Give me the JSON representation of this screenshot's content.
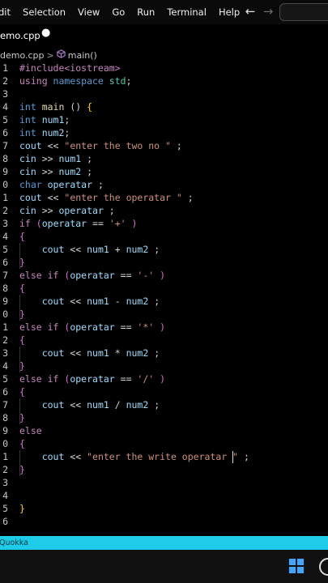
{
  "menubar": {
    "items": [
      "dit",
      "Selection",
      "View",
      "Go",
      "Run",
      "Terminal",
      "Help"
    ]
  },
  "nav": {
    "back_glyph": "←",
    "forward_glyph": "→"
  },
  "tab": {
    "title": "emo.cpp",
    "dirty_glyph": "●"
  },
  "breadcrumb": {
    "file": "demo.cpp",
    "separator": ">",
    "symbol": "main()",
    "symbol_icon": "cube-icon"
  },
  "editor": {
    "lines": [
      {
        "n": "1",
        "tokens": [
          {
            "t": "#include<iostream>",
            "c": "t-ctl"
          }
        ]
      },
      {
        "n": "2",
        "tokens": [
          {
            "t": "using ",
            "c": "t-ctl"
          },
          {
            "t": "namespace ",
            "c": "t-kw"
          },
          {
            "t": "std",
            "c": "t-ty"
          },
          {
            "t": ";",
            "c": "t-op"
          }
        ]
      },
      {
        "n": "3",
        "tokens": []
      },
      {
        "n": "4",
        "tokens": [
          {
            "t": "int ",
            "c": "t-kw"
          },
          {
            "t": "main",
            "c": "t-fn"
          },
          {
            "t": " () ",
            "c": "t-op"
          },
          {
            "t": "{",
            "c": "t-br2"
          }
        ]
      },
      {
        "n": "5",
        "tokens": [
          {
            "t": "int ",
            "c": "t-kw"
          },
          {
            "t": "num1",
            "c": "t-id"
          },
          {
            "t": ";",
            "c": "t-op"
          }
        ]
      },
      {
        "n": "6",
        "tokens": [
          {
            "t": "int ",
            "c": "t-kw"
          },
          {
            "t": "num2",
            "c": "t-id"
          },
          {
            "t": ";",
            "c": "t-op"
          }
        ]
      },
      {
        "n": "7",
        "tokens": [
          {
            "t": "cout",
            "c": "t-id"
          },
          {
            "t": " << ",
            "c": "t-op"
          },
          {
            "t": "\"enter the two no \"",
            "c": "t-str"
          },
          {
            "t": " ;",
            "c": "t-op"
          }
        ]
      },
      {
        "n": "8",
        "tokens": [
          {
            "t": "cin",
            "c": "t-id"
          },
          {
            "t": " >> ",
            "c": "t-op"
          },
          {
            "t": "num1",
            "c": "t-id"
          },
          {
            "t": " ;",
            "c": "t-op"
          }
        ]
      },
      {
        "n": "9",
        "tokens": [
          {
            "t": "cin",
            "c": "t-id"
          },
          {
            "t": " >> ",
            "c": "t-op"
          },
          {
            "t": "num2",
            "c": "t-id"
          },
          {
            "t": " ;",
            "c": "t-op"
          }
        ]
      },
      {
        "n": "0",
        "tokens": [
          {
            "t": "char ",
            "c": "t-kw"
          },
          {
            "t": "operatar",
            "c": "t-id"
          },
          {
            "t": " ;",
            "c": "t-op"
          }
        ]
      },
      {
        "n": "1",
        "tokens": [
          {
            "t": "cout",
            "c": "t-id"
          },
          {
            "t": " << ",
            "c": "t-op"
          },
          {
            "t": "\"enter the operatar \"",
            "c": "t-str"
          },
          {
            "t": " ;",
            "c": "t-op"
          }
        ]
      },
      {
        "n": "2",
        "tokens": [
          {
            "t": "cin",
            "c": "t-id"
          },
          {
            "t": " >> ",
            "c": "t-op"
          },
          {
            "t": "operatar",
            "c": "t-id"
          },
          {
            "t": " ;",
            "c": "t-op"
          }
        ]
      },
      {
        "n": "3",
        "tokens": [
          {
            "t": "if ",
            "c": "t-ctl"
          },
          {
            "t": "(",
            "c": "t-br1"
          },
          {
            "t": "operatar",
            "c": "t-id"
          },
          {
            "t": " == ",
            "c": "t-op"
          },
          {
            "t": "'+'",
            "c": "t-str"
          },
          {
            "t": " ",
            "c": "t-op"
          },
          {
            "t": ")",
            "c": "t-br1"
          }
        ]
      },
      {
        "n": "4",
        "tokens": [
          {
            "t": "{",
            "c": "t-br1"
          }
        ]
      },
      {
        "n": "5",
        "tokens": [
          {
            "t": "    cout",
            "c": "t-id"
          },
          {
            "t": " << ",
            "c": "t-op"
          },
          {
            "t": "num1",
            "c": "t-id"
          },
          {
            "t": " + ",
            "c": "t-op"
          },
          {
            "t": "num2",
            "c": "t-id"
          },
          {
            "t": " ;",
            "c": "t-op"
          }
        ]
      },
      {
        "n": "6",
        "tokens": [
          {
            "t": "}",
            "c": "t-br1"
          }
        ]
      },
      {
        "n": "7",
        "tokens": [
          {
            "t": "else if ",
            "c": "t-ctl"
          },
          {
            "t": "(",
            "c": "t-br1"
          },
          {
            "t": "operatar",
            "c": "t-id"
          },
          {
            "t": " == ",
            "c": "t-op"
          },
          {
            "t": "'-'",
            "c": "t-str"
          },
          {
            "t": " ",
            "c": "t-op"
          },
          {
            "t": ")",
            "c": "t-br1"
          }
        ]
      },
      {
        "n": "8",
        "tokens": [
          {
            "t": "{",
            "c": "t-br1"
          }
        ]
      },
      {
        "n": "9",
        "tokens": [
          {
            "t": "    cout",
            "c": "t-id"
          },
          {
            "t": " << ",
            "c": "t-op"
          },
          {
            "t": "num1",
            "c": "t-id"
          },
          {
            "t": " - ",
            "c": "t-op"
          },
          {
            "t": "num2",
            "c": "t-id"
          },
          {
            "t": " ;",
            "c": "t-op"
          }
        ]
      },
      {
        "n": "0",
        "tokens": [
          {
            "t": "}",
            "c": "t-br1"
          }
        ]
      },
      {
        "n": "1",
        "tokens": [
          {
            "t": "else if ",
            "c": "t-ctl"
          },
          {
            "t": "(",
            "c": "t-br1"
          },
          {
            "t": "operatar",
            "c": "t-id"
          },
          {
            "t": " == ",
            "c": "t-op"
          },
          {
            "t": "'*'",
            "c": "t-str"
          },
          {
            "t": " ",
            "c": "t-op"
          },
          {
            "t": ")",
            "c": "t-br1"
          }
        ]
      },
      {
        "n": "2",
        "tokens": [
          {
            "t": "{",
            "c": "t-br1"
          }
        ]
      },
      {
        "n": "3",
        "tokens": [
          {
            "t": "    cout",
            "c": "t-id"
          },
          {
            "t": " << ",
            "c": "t-op"
          },
          {
            "t": "num1",
            "c": "t-id"
          },
          {
            "t": " * ",
            "c": "t-op"
          },
          {
            "t": "num2",
            "c": "t-id"
          },
          {
            "t": " ;",
            "c": "t-op"
          }
        ]
      },
      {
        "n": "4",
        "tokens": [
          {
            "t": "}",
            "c": "t-br1"
          }
        ]
      },
      {
        "n": "5",
        "tokens": [
          {
            "t": "else if ",
            "c": "t-ctl"
          },
          {
            "t": "(",
            "c": "t-br1"
          },
          {
            "t": "operatar",
            "c": "t-id"
          },
          {
            "t": " == ",
            "c": "t-op"
          },
          {
            "t": "'/'",
            "c": "t-str"
          },
          {
            "t": " ",
            "c": "t-op"
          },
          {
            "t": ")",
            "c": "t-br1"
          }
        ]
      },
      {
        "n": "6",
        "tokens": [
          {
            "t": "{",
            "c": "t-br1"
          }
        ]
      },
      {
        "n": "7",
        "tokens": [
          {
            "t": "    cout",
            "c": "t-id"
          },
          {
            "t": " << ",
            "c": "t-op"
          },
          {
            "t": "num1",
            "c": "t-id"
          },
          {
            "t": " / ",
            "c": "t-op"
          },
          {
            "t": "num2",
            "c": "t-id"
          },
          {
            "t": " ;",
            "c": "t-op"
          }
        ]
      },
      {
        "n": "8",
        "tokens": [
          {
            "t": "}",
            "c": "t-br1"
          }
        ]
      },
      {
        "n": "9",
        "tokens": [
          {
            "t": "else",
            "c": "t-ctl"
          }
        ]
      },
      {
        "n": "0",
        "tokens": [
          {
            "t": "{",
            "c": "t-br1"
          }
        ]
      },
      {
        "n": "1",
        "tokens": [
          {
            "t": "    cout",
            "c": "t-id"
          },
          {
            "t": " << ",
            "c": "t-op"
          },
          {
            "t": "\"enter the write operatar \"",
            "c": "t-str"
          },
          {
            "t": " ;",
            "c": "t-op"
          }
        ]
      },
      {
        "n": "2",
        "tokens": [
          {
            "t": "}",
            "c": "t-br1"
          }
        ]
      },
      {
        "n": "3",
        "tokens": []
      },
      {
        "n": "4",
        "tokens": []
      },
      {
        "n": "5",
        "tokens": [
          {
            "t": "}",
            "c": "t-br2"
          }
        ]
      },
      {
        "n": "6",
        "tokens": []
      }
    ]
  },
  "status": {
    "text": "Quokka"
  }
}
